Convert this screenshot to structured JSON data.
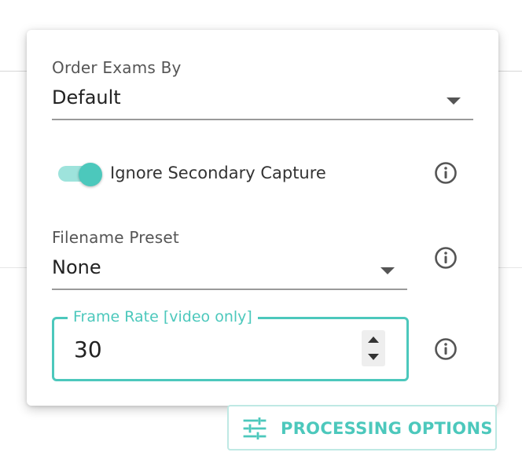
{
  "order_exams": {
    "label": "Order Exams By",
    "value": "Default"
  },
  "ignore_secondary": {
    "label": "Ignore Secondary Capture",
    "enabled": true
  },
  "filename_preset": {
    "label": "Filename Preset",
    "value": "None"
  },
  "frame_rate": {
    "label": "Frame Rate [video only]",
    "value": "30"
  },
  "processing_button": {
    "label": "PROCESSING OPTIONS",
    "icon": "sliders-icon"
  },
  "colors": {
    "accent": "#4cc8bc",
    "toggle_track": "#9ee3dc",
    "icon_gray": "#555555"
  },
  "icons": {
    "info": "info-circle-icon",
    "dropdown": "caret-down-icon"
  }
}
